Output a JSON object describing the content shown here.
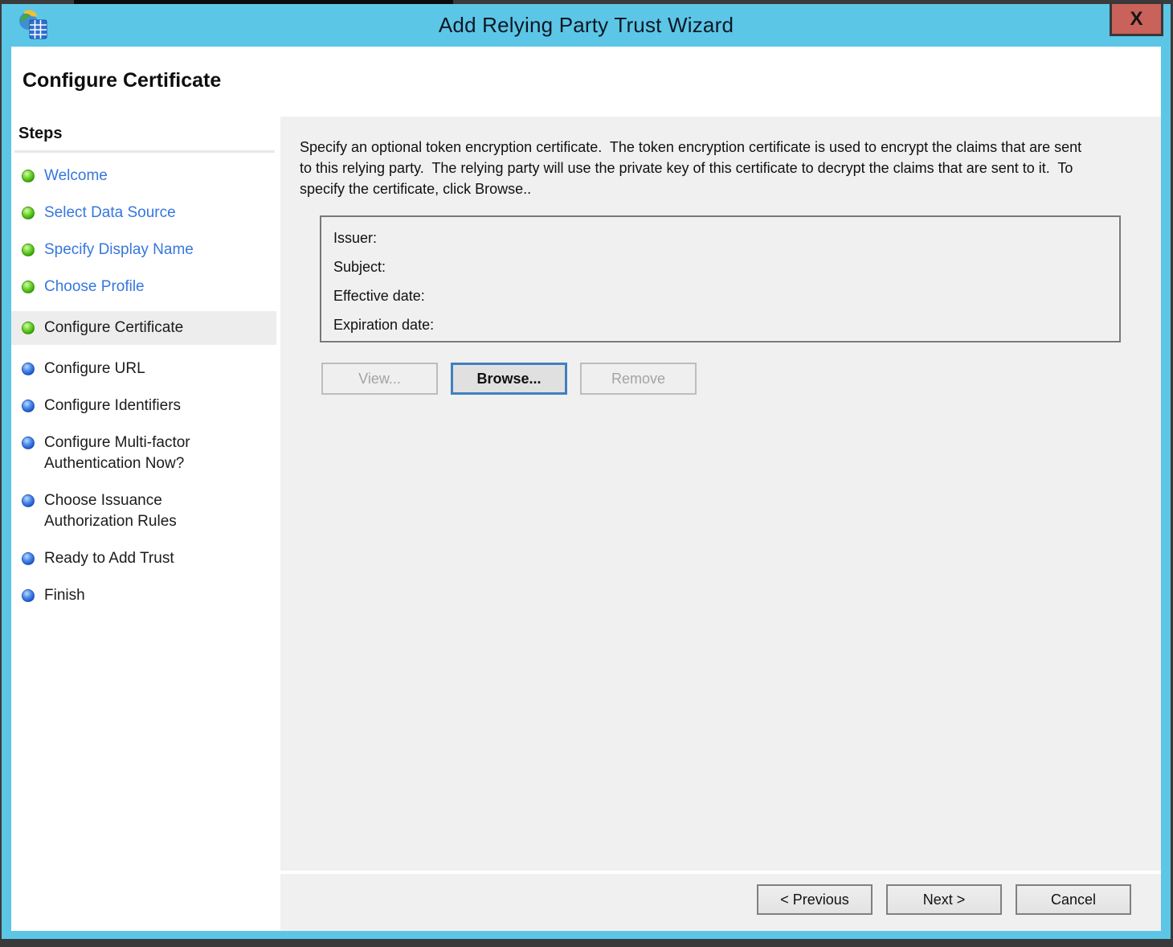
{
  "window": {
    "title": "Add Relying Party Trust Wizard",
    "close_label": "X",
    "icon": "adfs-wizard-icon"
  },
  "header": {
    "title": "Configure Certificate"
  },
  "sidebar": {
    "heading": "Steps",
    "items": [
      {
        "label": "Welcome",
        "state": "done"
      },
      {
        "label": "Select Data Source",
        "state": "done"
      },
      {
        "label": "Specify Display Name",
        "state": "done"
      },
      {
        "label": "Choose Profile",
        "state": "done"
      },
      {
        "label": "Configure Certificate",
        "state": "current"
      },
      {
        "label": "Configure URL",
        "state": "pending"
      },
      {
        "label": "Configure Identifiers",
        "state": "pending"
      },
      {
        "label": "Configure Multi-factor Authentication Now?",
        "state": "pending"
      },
      {
        "label": "Choose Issuance Authorization Rules",
        "state": "pending"
      },
      {
        "label": "Ready to Add Trust",
        "state": "pending"
      },
      {
        "label": "Finish",
        "state": "pending"
      }
    ]
  },
  "main": {
    "description": "Specify an optional token encryption certificate.  The token encryption certificate is used to encrypt the claims that are sent to this relying party.  The relying party will use the private key of this certificate to decrypt the claims that are sent to it.  To specify the certificate, click Browse..",
    "certificate_panel": {
      "fields": [
        {
          "label": "Issuer:",
          "value": ""
        },
        {
          "label": "Subject:",
          "value": ""
        },
        {
          "label": "Effective date:",
          "value": ""
        },
        {
          "label": "Expiration date:",
          "value": ""
        }
      ]
    },
    "actions": {
      "view": "View...",
      "browse": "Browse...",
      "remove": "Remove"
    }
  },
  "footer": {
    "previous": "< Previous",
    "next": "Next >",
    "cancel": "Cancel"
  },
  "colors": {
    "titlebar_blue": "#5cc6e6",
    "close_button_red": "#c9625b",
    "link_blue": "#3677dd",
    "panel_gray": "#f0f0f0",
    "done_bullet_green": "#3aa80c",
    "pending_bullet_blue": "#2e79e6",
    "focus_border_blue": "#4080c0"
  }
}
